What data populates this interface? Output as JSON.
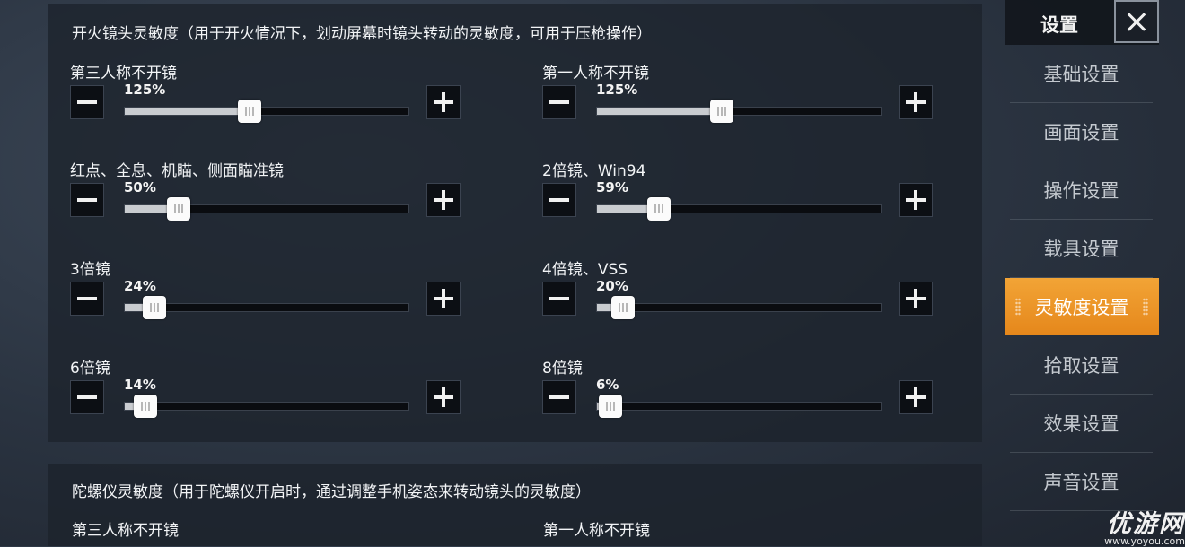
{
  "panel": {
    "section_title": "开火镜头灵敏度（用于开火情况下，划动屏幕时镜头转动的灵敏度，可用于压枪操作）",
    "settings": [
      {
        "label": "第三人称不开镜",
        "value_text": "125%",
        "level": 0.41
      },
      {
        "label": "第一人称不开镜",
        "value_text": "125%",
        "level": 0.41
      },
      {
        "label": "红点、全息、机瞄、侧面瞄准镜",
        "value_text": "50%",
        "level": 0.16
      },
      {
        "label": "2倍镜、Win94",
        "value_text": "59%",
        "level": 0.19
      },
      {
        "label": "3倍镜",
        "value_text": "24%",
        "level": 0.075
      },
      {
        "label": "4倍镜、VSS",
        "value_text": "20%",
        "level": 0.062
      },
      {
        "label": "6倍镜",
        "value_text": "14%",
        "level": 0.043
      },
      {
        "label": "8倍镜",
        "value_text": "6%",
        "level": 0.02
      }
    ]
  },
  "panel2": {
    "section_title": "陀螺仪灵敏度（用于陀螺仪开启时，通过调整手机姿态来转动镜头的灵敏度）",
    "partial_labels": [
      "第三人称不开镜",
      "第一人称不开镜"
    ]
  },
  "sidebar": {
    "title": "设置",
    "items": [
      {
        "label": "基础设置"
      },
      {
        "label": "画面设置"
      },
      {
        "label": "操作设置"
      },
      {
        "label": "载具设置"
      },
      {
        "label": "灵敏度设置",
        "active": true
      },
      {
        "label": "拾取设置"
      },
      {
        "label": "效果设置"
      },
      {
        "label": "声音设置"
      }
    ]
  },
  "watermark": {
    "big": "优游网",
    "small": "www.yoyou.com"
  },
  "colors": {
    "accent": "#ee9a2a",
    "panel": "#1c222c",
    "knob": "#fbfbfb"
  },
  "icons": {
    "minus": "minus-icon",
    "plus": "plus-icon",
    "close": "close-icon"
  }
}
